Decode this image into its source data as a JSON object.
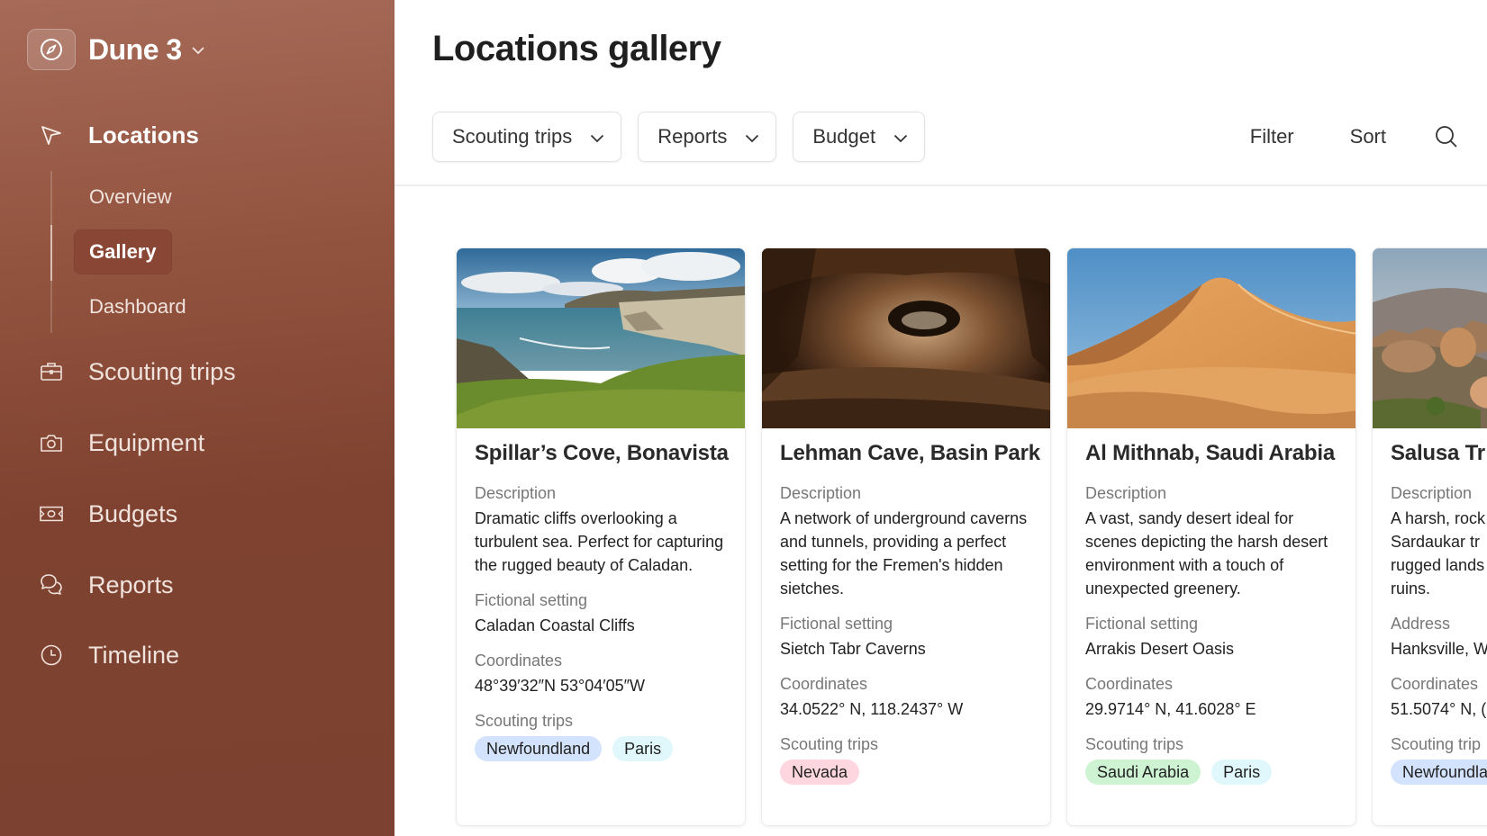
{
  "app": {
    "project_name": "Dune 3",
    "brand_icon": "compass-icon"
  },
  "sidebar": {
    "section": {
      "label": "Locations",
      "icon": "navigation-arrow-icon"
    },
    "sub_items": [
      {
        "label": "Overview"
      },
      {
        "label": "Gallery",
        "active": true
      },
      {
        "label": "Dashboard"
      }
    ],
    "items": [
      {
        "label": "Scouting trips",
        "icon": "briefcase-icon"
      },
      {
        "label": "Equipment",
        "icon": "camera-icon"
      },
      {
        "label": "Budgets",
        "icon": "banknote-icon"
      },
      {
        "label": "Reports",
        "icon": "chat-bubbles-icon"
      },
      {
        "label": "Timeline",
        "icon": "clock-icon"
      }
    ]
  },
  "header": {
    "title": "Locations gallery",
    "filters": [
      {
        "label": "Scouting trips"
      },
      {
        "label": "Reports"
      },
      {
        "label": "Budget"
      }
    ],
    "filter_label": "Filter",
    "sort_label": "Sort",
    "search_icon": "search-icon"
  },
  "colors": {
    "sidebar_top": "#a66a58",
    "sidebar_bottom": "#7c4130",
    "active_subitem": "#8a4634",
    "tag_blue": "#d3e3fd",
    "tag_cyan": "#e0f8fb",
    "tag_pink": "#fdd6df",
    "tag_green": "#cdf3d3"
  },
  "cards": [
    {
      "title": "Spillar’s Cove, Bonavista",
      "image": "coastal-cliffs-photo",
      "desc_label": "Description",
      "description": "Dramatic cliffs overlooking a turbulent sea. Perfect for capturing the rugged beauty of Caladan.",
      "field2_label": "Fictional setting",
      "field2_value": "Caladan Coastal Cliffs",
      "coord_label": "Coordinates",
      "coordinates": "48°39′32″N 53°04′05″W",
      "trips_label": "Scouting trips",
      "trips": [
        {
          "label": "Newfoundland",
          "color": "#d3e3fd"
        },
        {
          "label": "Paris",
          "color": "#e0f8fb"
        }
      ]
    },
    {
      "title": "Lehman Cave, Basin Park",
      "image": "cave-photo",
      "desc_label": "Description",
      "description": "A network of underground caverns and tunnels, providing a perfect setting for the Fremen's hidden sietches.",
      "field2_label": "Fictional setting",
      "field2_value": "Sietch Tabr Caverns",
      "coord_label": "Coordinates",
      "coordinates": "34.0522° N, 118.2437° W",
      "trips_label": "Scouting trips",
      "trips": [
        {
          "label": "Nevada",
          "color": "#fdd6df"
        }
      ]
    },
    {
      "title": "Al Mithnab, Saudi Arabia",
      "image": "desert-dunes-photo",
      "desc_label": "Description",
      "description": "A vast, sandy desert ideal for scenes depicting the harsh desert environment with a touch of unexpected greenery.",
      "field2_label": "Fictional setting",
      "field2_value": "Arrakis Desert Oasis",
      "coord_label": "Coordinates",
      "coordinates": "29.9714° N, 41.6028° E",
      "trips_label": "Scouting trips",
      "trips": [
        {
          "label": "Saudi Arabia",
          "color": "#cdf3d3"
        },
        {
          "label": "Paris",
          "color": "#e0f8fb"
        }
      ]
    },
    {
      "title": "Salusa Tr",
      "image": "rocky-mountain-photo",
      "desc_label": "Description",
      "description": "A harsh, rock Sardaukar tr rugged lands ruins.",
      "description_lines": [
        "A harsh, rock",
        "Sardaukar tr",
        "rugged lands",
        "ruins."
      ],
      "field2_label": "Address",
      "field2_value": "Hanksville, W",
      "coord_label": "Coordinates",
      "coordinates": "51.5074° N, (",
      "trips_label": "Scouting trip",
      "trips": [
        {
          "label": "Newfoundla",
          "color": "#d3e3fd"
        }
      ]
    }
  ]
}
